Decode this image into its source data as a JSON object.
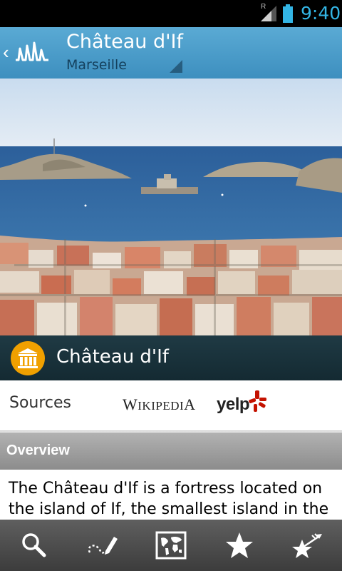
{
  "status_bar": {
    "time": "9:40",
    "roaming_indicator": "R",
    "icons": [
      "signal-icon",
      "battery-icon"
    ],
    "accent_color": "#33b5e5"
  },
  "app_bar": {
    "title": "Château d'If",
    "subtitle": "Marseille",
    "icons": [
      "back-chevron-icon",
      "app-logo-icon",
      "dropdown-triangle-icon"
    ],
    "background_color": "#4a9dcb"
  },
  "hero_photo": {
    "subject": "photo"
  },
  "poi": {
    "title": "Château d'If",
    "category_icon": "museum-icon",
    "icon_color": "#f0a000"
  },
  "sources": {
    "label": "Sources",
    "wikipedia": "Wikipedia",
    "yelp": "yelp"
  },
  "overview": {
    "header": "Overview",
    "text": "The Château d'If is a fortress located on the island of If, the smallest island in the"
  },
  "bottom_nav": {
    "items": [
      {
        "icon": "search-icon"
      },
      {
        "icon": "route-pen-icon"
      },
      {
        "icon": "world-map-icon"
      },
      {
        "icon": "star-icon"
      },
      {
        "icon": "favorites-arrow-icon"
      }
    ]
  }
}
